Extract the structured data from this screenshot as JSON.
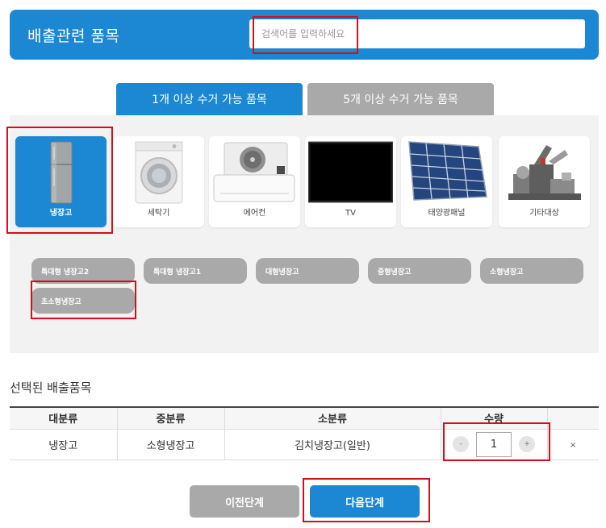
{
  "header": {
    "title": "배출관련 품목",
    "search_placeholder": "검색어를 입력하세요"
  },
  "tabs": [
    {
      "label": "1개 이상 수거 가능 품목",
      "active": true
    },
    {
      "label": "5개 이상 수거 가능 품목",
      "active": false
    }
  ],
  "categories": [
    {
      "label": "냉장고",
      "icon": "refrigerator-icon",
      "active": true
    },
    {
      "label": "세탁기",
      "icon": "washing-machine-icon",
      "active": false
    },
    {
      "label": "에어컨",
      "icon": "air-conditioner-icon",
      "active": false
    },
    {
      "label": "TV",
      "icon": "tv-icon",
      "active": false
    },
    {
      "label": "태양광패널",
      "icon": "solar-panel-icon",
      "active": false
    },
    {
      "label": "기타대상",
      "icon": "misc-items-icon",
      "active": false
    }
  ],
  "subcategories": [
    "특대형 냉장고2",
    "특대형 냉장고1",
    "대형냉장고",
    "중형냉장고",
    "소형냉장고",
    "초소형냉장고"
  ],
  "selected": {
    "title": "선택된 배출품목",
    "columns": [
      "대분류",
      "중분류",
      "소분류",
      "수량"
    ],
    "rows": [
      {
        "major": "냉장고",
        "middle": "소형냉장고",
        "minor": "김치냉장고(일반)",
        "quantity": "1"
      }
    ],
    "minus_label": "-",
    "plus_label": "+",
    "delete_label": "×"
  },
  "buttons": {
    "prev": "이전단계",
    "next": "다음단계"
  },
  "colors": {
    "primary": "#1c87d3",
    "inactive": "#a9a9a9",
    "highlight": "#d20f1d",
    "panel_bg": "#f2f2f2"
  }
}
